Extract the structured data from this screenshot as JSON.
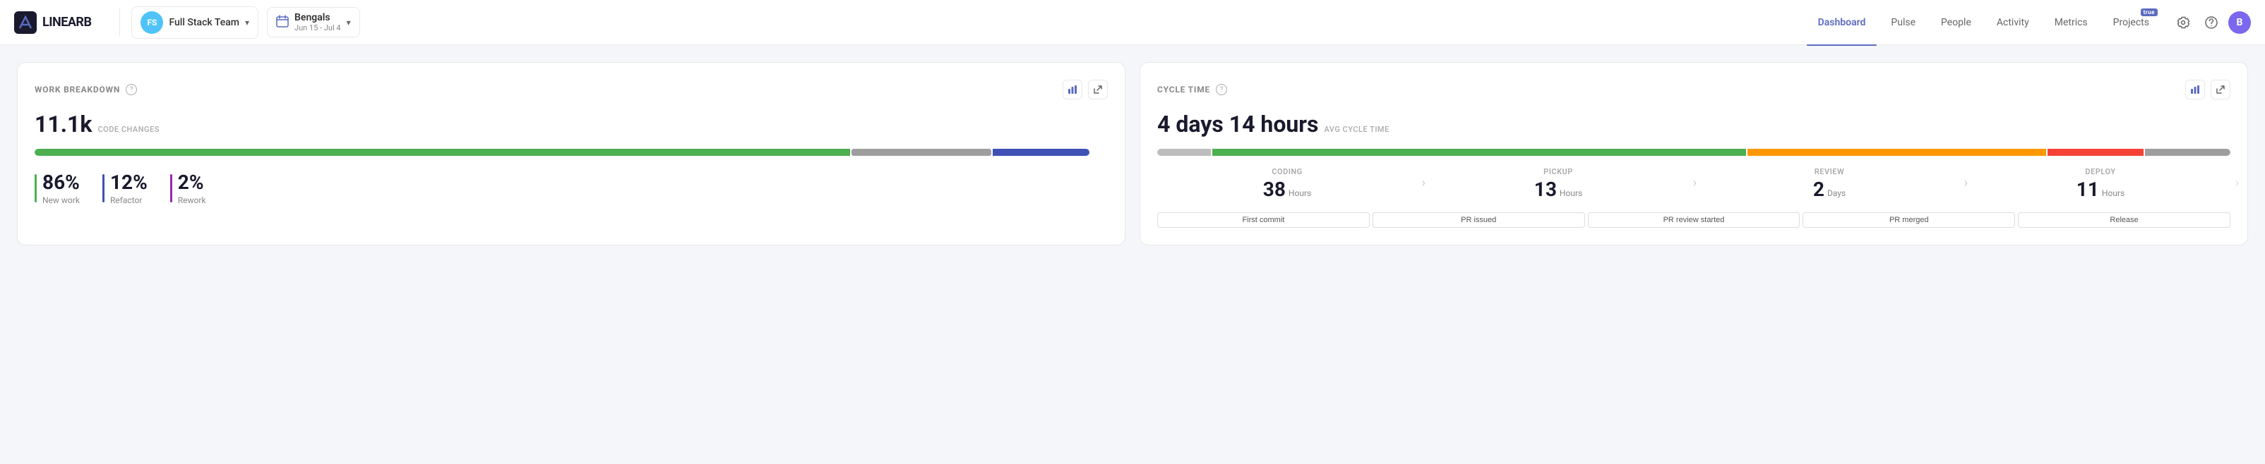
{
  "app": {
    "logo_text": "LINEARB",
    "logo_icon": "LB"
  },
  "header": {
    "team": {
      "initials": "FS",
      "name": "Full Stack Team",
      "avatar_bg": "#4fc3f7"
    },
    "sprint": {
      "name": "Bengals",
      "dates": "Jun 15 - Jul 4"
    },
    "nav": [
      {
        "label": "Dashboard",
        "active": true
      },
      {
        "label": "Pulse",
        "active": false
      },
      {
        "label": "People",
        "active": false
      },
      {
        "label": "Activity",
        "active": false
      },
      {
        "label": "Metrics",
        "active": false
      },
      {
        "label": "Projects",
        "active": false,
        "beta": true
      }
    ],
    "user_initial": "B",
    "user_bg": "#7b68ee"
  },
  "work_breakdown": {
    "title": "WORK BREAKDOWN",
    "code_changes_value": "11.1k",
    "code_changes_label": "CODE CHANGES",
    "progress": [
      {
        "color": "#4caf50",
        "width": 76
      },
      {
        "color": "#9e9e9e",
        "width": 15
      },
      {
        "color": "#3f51b5",
        "width": 9
      }
    ],
    "stats": [
      {
        "pct": "86%",
        "label": "New work",
        "color": "#4caf50"
      },
      {
        "pct": "12%",
        "label": "Refactor",
        "color": "#3f51b5"
      },
      {
        "pct": "2%",
        "label": "Rework",
        "color": "#9c27b0"
      }
    ]
  },
  "cycle_time": {
    "title": "CYCLE TIME",
    "avg_days": "4 days 14 hours",
    "avg_label": "AVG CYCLE TIME",
    "bar": [
      {
        "color": "#bdbdbd",
        "width": 5
      },
      {
        "color": "#4caf50",
        "width": 50
      },
      {
        "color": "#ff9800",
        "width": 28
      },
      {
        "color": "#f44336",
        "width": 9
      },
      {
        "color": "#9e9e9e",
        "width": 8
      }
    ],
    "stages": [
      {
        "label": "CODING",
        "value": "38",
        "unit": "Hours"
      },
      {
        "label": "PICKUP",
        "value": "13",
        "unit": "Hours"
      },
      {
        "label": "REVIEW",
        "value": "2",
        "unit": "Days"
      },
      {
        "label": "DEPLOY",
        "value": "11",
        "unit": "Hours"
      }
    ],
    "milestones": [
      "First commit",
      "PR issued",
      "PR review started",
      "PR merged",
      "Release"
    ]
  },
  "icons": {
    "chevron_down": "▾",
    "chart_bar": "▊",
    "expand": "↗",
    "calendar": "▦",
    "gear": "⚙",
    "question": "?",
    "help": "?"
  }
}
